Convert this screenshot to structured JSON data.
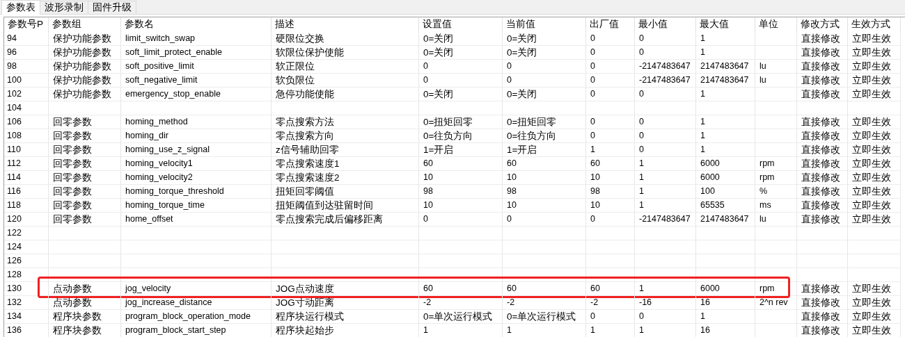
{
  "tabs": [
    {
      "label": "参数表",
      "selected": true
    },
    {
      "label": "波形录制",
      "selected": false
    },
    {
      "label": "固件升级",
      "selected": false
    }
  ],
  "table": {
    "columns": [
      "参数号P",
      "参数组",
      "参数名",
      "描述",
      "设置值",
      "当前值",
      "出厂值",
      "最小值",
      "最大值",
      "单位",
      "修改方式",
      "生效方式"
    ],
    "rows": [
      {
        "no": "94",
        "group": "保护功能参数",
        "name": "limit_switch_swap",
        "desc": "硬限位交换",
        "set": "0=关闭",
        "cur": "0=关闭",
        "factory": "0",
        "min": "0",
        "max": "1",
        "mode": "直接修改",
        "effect": "立即生效",
        "highlighted": false
      },
      {
        "no": "96",
        "group": "保护功能参数",
        "name": "soft_limit_protect_enable",
        "desc": "软限位保护使能",
        "set": "0=关闭",
        "cur": "0=关闭",
        "factory": "0",
        "min": "0",
        "max": "1",
        "mode": "直接修改",
        "effect": "立即生效",
        "highlighted": false
      },
      {
        "no": "98",
        "group": "保护功能参数",
        "name": "soft_positive_limit",
        "desc": "软正限位",
        "set": "0",
        "cur": "0",
        "factory": "0",
        "min": "-2147483647",
        "max": "2147483647",
        "unit": "lu",
        "mode": "直接修改",
        "effect": "立即生效",
        "highlighted": false
      },
      {
        "no": "100",
        "group": "保护功能参数",
        "name": "soft_negative_limit",
        "desc": "软负限位",
        "set": "0",
        "cur": "0",
        "factory": "0",
        "min": "-2147483647",
        "max": "2147483647",
        "unit": "lu",
        "mode": "直接修改",
        "effect": "立即生效",
        "highlighted": false
      },
      {
        "no": "102",
        "group": "保护功能参数",
        "name": "emergency_stop_enable",
        "desc": "急停功能使能",
        "set": "0=关闭",
        "cur": "0=关闭",
        "factory": "0",
        "min": "0",
        "max": "1",
        "mode": "直接修改",
        "effect": "立即生效",
        "highlighted": false
      },
      {
        "no": "104",
        "highlighted": false
      },
      {
        "no": "106",
        "group": "回零参数",
        "name": "homing_method",
        "desc": "零点搜索方法",
        "set": "0=扭矩回零",
        "cur": "0=扭矩回零",
        "factory": "0",
        "min": "0",
        "max": "1",
        "mode": "直接修改",
        "effect": "立即生效",
        "highlighted": false
      },
      {
        "no": "108",
        "group": "回零参数",
        "name": "homing_dir",
        "desc": "零点搜索方向",
        "set": "0=往负方向",
        "cur": "0=往负方向",
        "factory": "0",
        "min": "0",
        "max": "1",
        "mode": "直接修改",
        "effect": "立即生效",
        "highlighted": false
      },
      {
        "no": "110",
        "group": "回零参数",
        "name": "homing_use_z_signal",
        "desc": "z信号辅助回零",
        "set": "1=开启",
        "cur": "1=开启",
        "factory": "1",
        "min": "0",
        "max": "1",
        "mode": "直接修改",
        "effect": "立即生效",
        "highlighted": false
      },
      {
        "no": "112",
        "group": "回零参数",
        "name": "homing_velocity1",
        "desc": "零点搜索速度1",
        "set": "60",
        "cur": "60",
        "factory": "60",
        "min": "1",
        "max": "6000",
        "unit": "rpm",
        "mode": "直接修改",
        "effect": "立即生效",
        "highlighted": false
      },
      {
        "no": "114",
        "group": "回零参数",
        "name": "homing_velocity2",
        "desc": "零点搜索速度2",
        "set": "10",
        "cur": "10",
        "factory": "10",
        "min": "1",
        "max": "6000",
        "unit": "rpm",
        "mode": "直接修改",
        "effect": "立即生效",
        "highlighted": false
      },
      {
        "no": "116",
        "group": "回零参数",
        "name": "homing_torque_threshold",
        "desc": "扭矩回零阈值",
        "set": "98",
        "cur": "98",
        "factory": "98",
        "min": "1",
        "max": "100",
        "unit": "%",
        "mode": "直接修改",
        "effect": "立即生效",
        "highlighted": false
      },
      {
        "no": "118",
        "group": "回零参数",
        "name": "homing_torque_time",
        "desc": "扭矩阈值到达驻留时间",
        "set": "10",
        "cur": "10",
        "factory": "10",
        "min": "1",
        "max": "65535",
        "unit": "ms",
        "mode": "直接修改",
        "effect": "立即生效",
        "highlighted": false
      },
      {
        "no": "120",
        "group": "回零参数",
        "name": "home_offset",
        "desc": "零点搜索完成后偏移距离",
        "set": "0",
        "cur": "0",
        "factory": "0",
        "min": "-2147483647",
        "max": "2147483647",
        "unit": "lu",
        "mode": "直接修改",
        "effect": "立即生效",
        "highlighted": false
      },
      {
        "no": "122",
        "highlighted": false
      },
      {
        "no": "124",
        "highlighted": false
      },
      {
        "no": "126",
        "highlighted": false
      },
      {
        "no": "128",
        "highlighted": false
      },
      {
        "no": "130",
        "group": "点动参数",
        "name": "jog_velocity",
        "desc": "JOG点动速度",
        "set": "60",
        "cur": "60",
        "factory": "60",
        "min": "1",
        "max": "6000",
        "unit": "rpm",
        "mode": "直接修改",
        "effect": "立即生效",
        "highlighted": true
      },
      {
        "no": "132",
        "group": "点动参数",
        "name": "jog_increase_distance",
        "desc": "JOG寸动距离",
        "set": "-2",
        "cur": "-2",
        "factory": "-2",
        "min": "-16",
        "max": "16",
        "unit": "2^n rev",
        "mode": "直接修改",
        "effect": "立即生效",
        "highlighted": false
      },
      {
        "no": "134",
        "group": "程序块参数",
        "name": "program_block_operation_mode",
        "desc": "程序块运行模式",
        "set": "0=单次运行模式",
        "cur": "0=单次运行模式",
        "factory": "0",
        "min": "0",
        "max": "1",
        "mode": "直接修改",
        "effect": "立即生效",
        "highlighted": false
      },
      {
        "no": "136",
        "group": "程序块参数",
        "name": "program_block_start_step",
        "desc": "程序块起始步",
        "set": "1",
        "cur": "1",
        "factory": "1",
        "min": "1",
        "max": "16",
        "mode": "直接修改",
        "effect": "立即生效",
        "highlighted": false
      }
    ]
  }
}
